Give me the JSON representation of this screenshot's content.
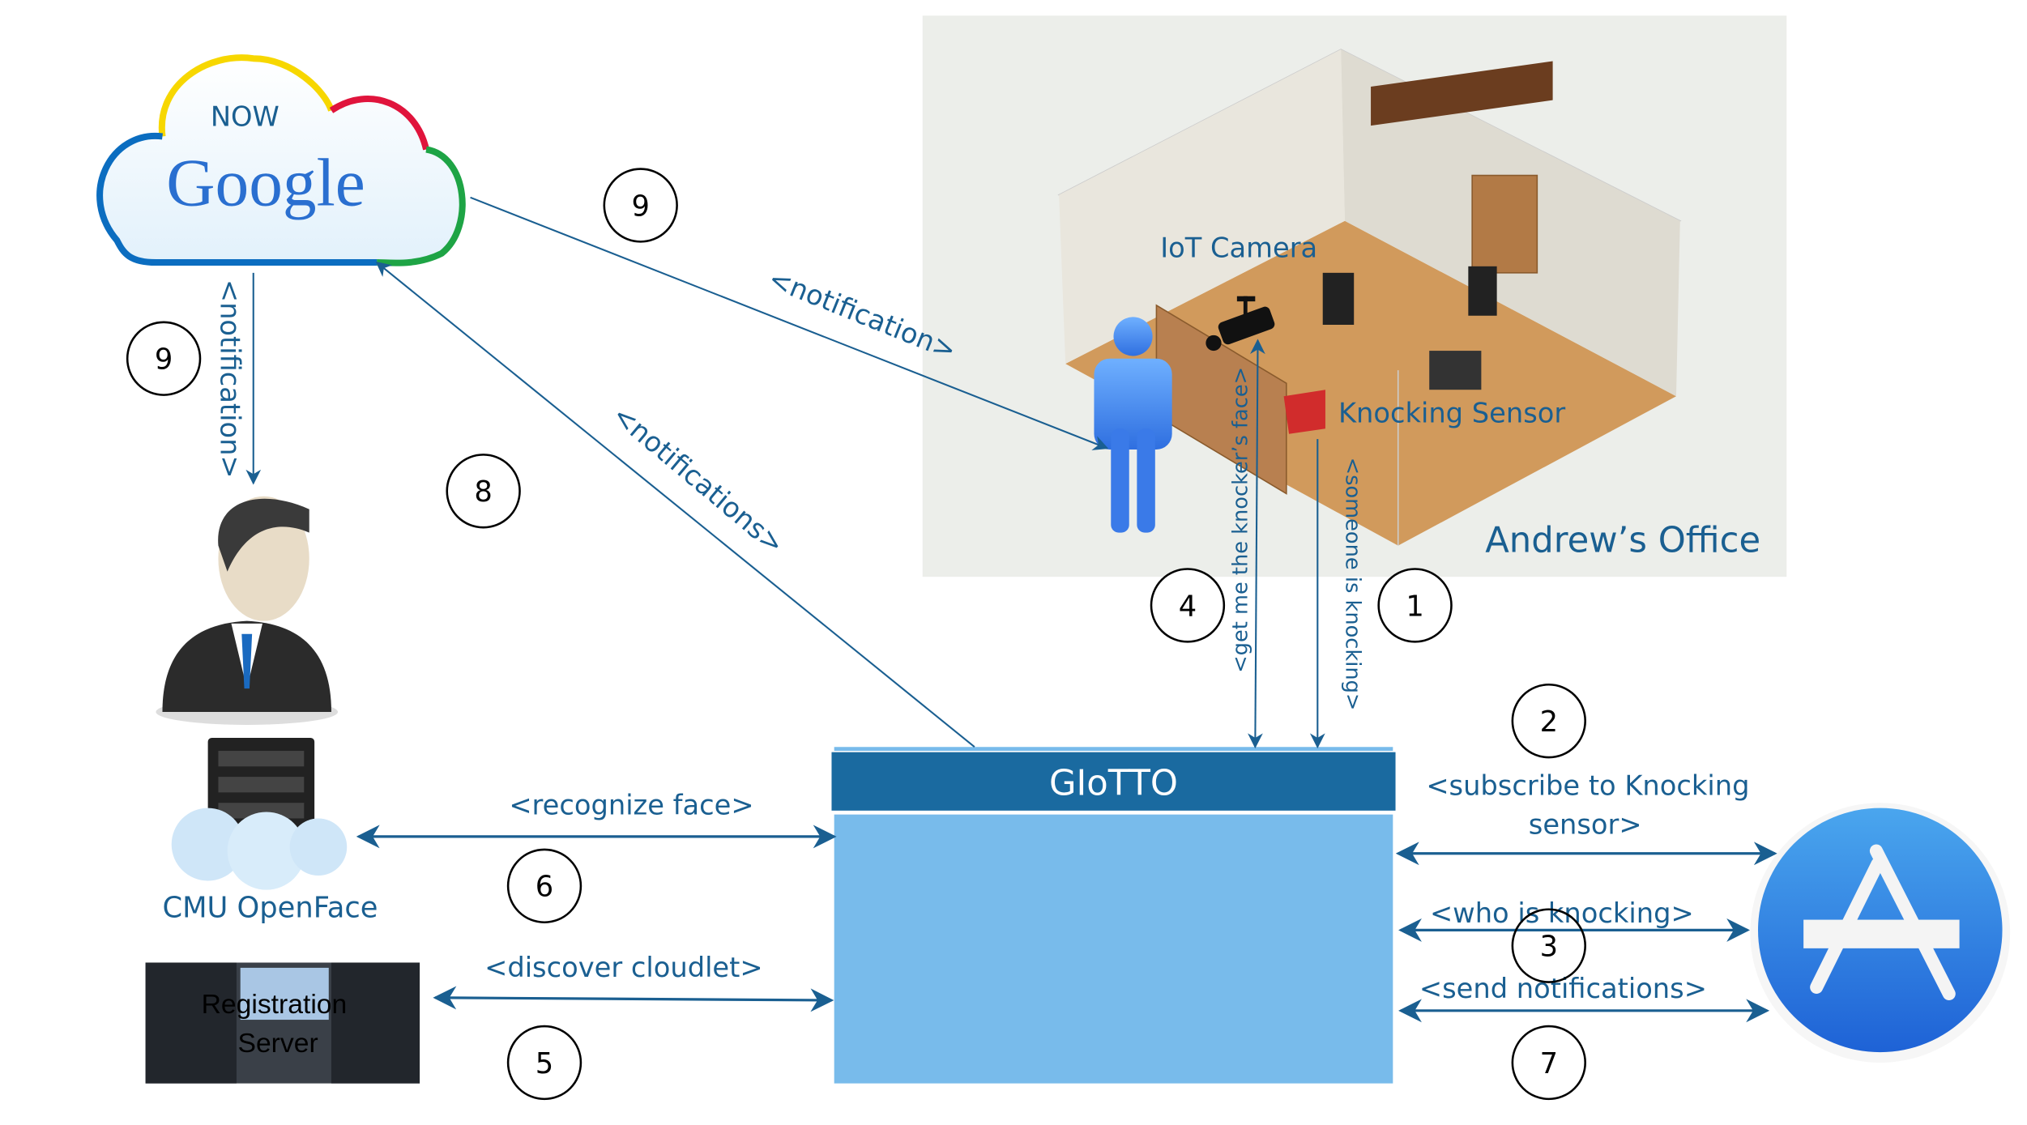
{
  "google": {
    "now_label": "NOW",
    "logo_text": "Google"
  },
  "office": {
    "title": "Andrew’s Office",
    "camera_label": "IoT Camera",
    "sensor_label": "Knocking Sensor"
  },
  "giotto": {
    "title": "GIoTTO"
  },
  "openface": {
    "label": "CMU OpenFace"
  },
  "registration": {
    "label_line1": "Registration",
    "label_line2": "Server"
  },
  "arrows": {
    "notification_user": "<notification>",
    "notification_office": "<notification>",
    "notifications_google": "<notifications>",
    "get_face": "<get me the knocker’s face>",
    "someone_knocking": "<someone is knocking>",
    "subscribe_line1": "<subscribe to Knocking",
    "subscribe_line2": "sensor>",
    "who_knocking": "<who is knocking>",
    "send_notifications": "<send notifications>",
    "recognize_face": "<recognize face>",
    "discover_cloudlet": "<discover cloudlet>"
  },
  "steps": [
    "1",
    "2",
    "3",
    "4",
    "5",
    "6",
    "7",
    "8",
    "9",
    "9"
  ],
  "colors": {
    "accent": "#1a5f91",
    "giotto_header": "#1a6aa0",
    "giotto_body": "#78bbeb",
    "appstore": "#3a8ae6",
    "sensor": "#d12c2c"
  }
}
